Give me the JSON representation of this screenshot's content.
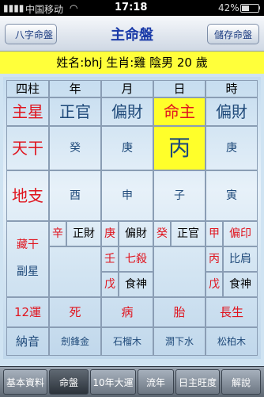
{
  "status": {
    "carrier": "中国移动",
    "time": "17:18",
    "battery": "42%"
  },
  "nav": {
    "title": "主命盤",
    "back_label": "八字命盤",
    "save_label": "儲存命盤"
  },
  "banner": "姓名:bhj  生肖:雞  陰男  20 歲",
  "headers": [
    "四柱",
    "年",
    "月",
    "日",
    "時"
  ],
  "rows": {
    "zhuxing": {
      "label": "主星",
      "values": [
        "正官",
        "偏財",
        "命主",
        "偏財"
      ]
    },
    "tiangan": {
      "label": "天干",
      "values": [
        "癸",
        "庚",
        "丙",
        "庚"
      ]
    },
    "dizhi": {
      "label": "地支",
      "values": [
        "酉",
        "申",
        "子",
        "寅"
      ]
    },
    "canggan": {
      "label1": "藏干",
      "label2": "副星",
      "year": [
        [
          "辛",
          "正財"
        ]
      ],
      "month": [
        [
          "庚",
          "偏財"
        ],
        [
          "壬",
          "七殺"
        ],
        [
          "戊",
          "食神"
        ]
      ],
      "day": [
        [
          "癸",
          "正官"
        ]
      ],
      "hour": [
        [
          "甲",
          "偏印"
        ],
        [
          "丙",
          "比肩"
        ],
        [
          "戊",
          "食神"
        ]
      ]
    },
    "yun12": {
      "label": "12運",
      "values": [
        "死",
        "病",
        "胎",
        "長生"
      ]
    },
    "nayin": {
      "label": "納音",
      "values": [
        "劍鋒金",
        "石榴木",
        "澗下水",
        "松柏木"
      ]
    }
  },
  "tabs": [
    "基本資料",
    "命盤",
    "10年大運",
    "流年",
    "日主旺度",
    "解說"
  ],
  "active_tab": "命盤"
}
